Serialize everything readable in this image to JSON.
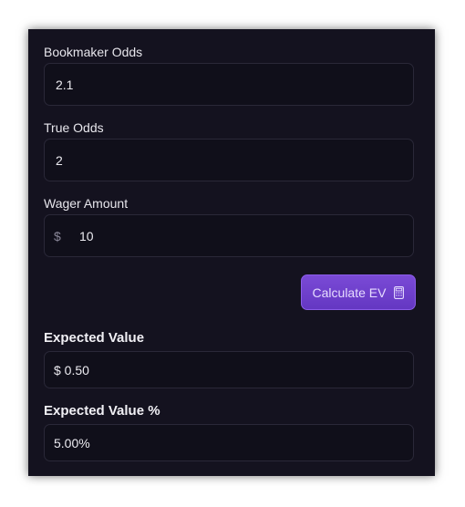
{
  "form": {
    "bookmaker_odds": {
      "label": "Bookmaker Odds",
      "value": "2.1"
    },
    "true_odds": {
      "label": "True Odds",
      "value": "2"
    },
    "wager_amount": {
      "label": "Wager Amount",
      "currency_symbol": "$",
      "value": "10"
    }
  },
  "action": {
    "calculate_label": "Calculate EV",
    "icon": "calculator-icon"
  },
  "results": {
    "expected_value": {
      "label": "Expected Value",
      "value": "$ 0.50"
    },
    "expected_value_pct": {
      "label": "Expected Value %",
      "value": "5.00%"
    }
  },
  "colors": {
    "background": "#14121f",
    "accent": "#6e3fd0",
    "text": "#ecebf1"
  }
}
